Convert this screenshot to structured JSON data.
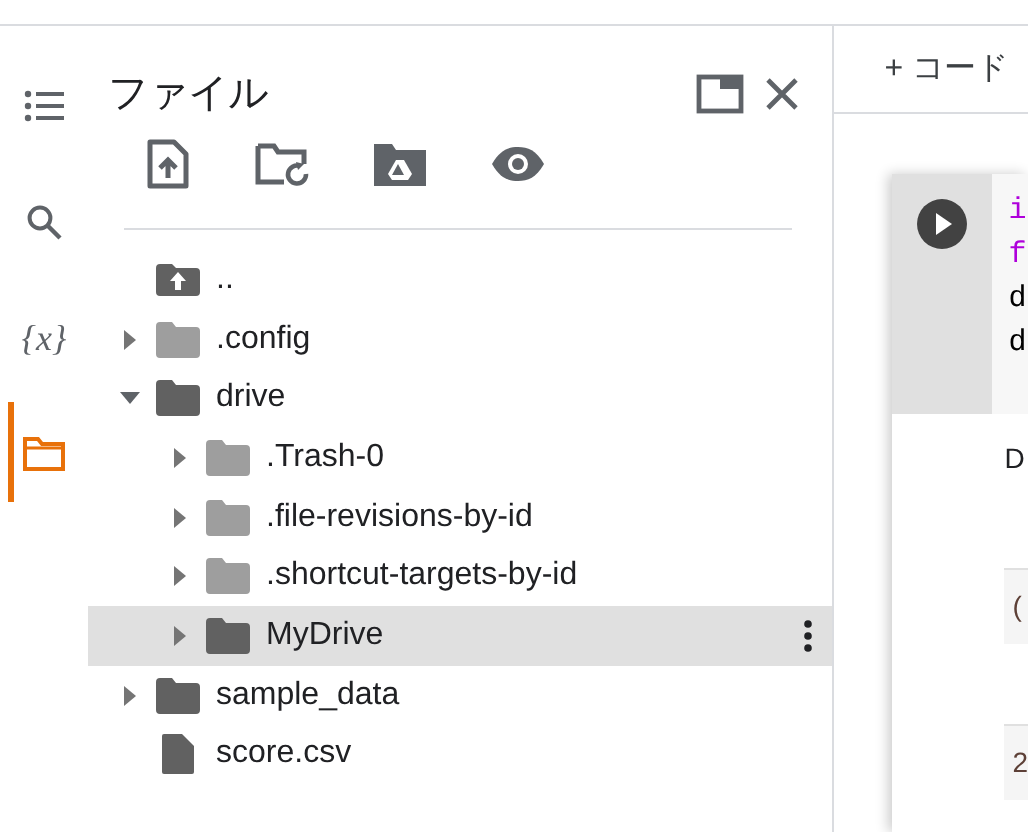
{
  "rail": [
    {
      "kind": "toc",
      "selected": false
    },
    {
      "kind": "search",
      "selected": false
    },
    {
      "kind": "variables",
      "label": "{x}",
      "selected": false
    },
    {
      "kind": "folder",
      "selected": true
    }
  ],
  "panel": {
    "title": "ファイル"
  },
  "tree": [
    {
      "kind": "parent",
      "name": "..",
      "selected": false
    },
    {
      "kind": "folder",
      "name": ".config",
      "dimmed": true,
      "expanded": false,
      "selected": false
    },
    {
      "kind": "folder",
      "name": "drive",
      "dimmed": false,
      "expanded": true,
      "selected": false,
      "children": [
        {
          "kind": "folder",
          "name": ".Trash-0",
          "dimmed": true,
          "expanded": false,
          "selected": false
        },
        {
          "kind": "folder",
          "name": ".file-revisions-by-id",
          "dimmed": true,
          "expanded": false,
          "selected": false
        },
        {
          "kind": "folder",
          "name": ".shortcut-targets-by-id",
          "dimmed": true,
          "expanded": false,
          "selected": false
        },
        {
          "kind": "folder",
          "name": "MyDrive",
          "dimmed": false,
          "expanded": false,
          "selected": true
        }
      ]
    },
    {
      "kind": "folder",
      "name": "sample_data",
      "dimmed": false,
      "expanded": false,
      "selected": false
    },
    {
      "kind": "file",
      "name": "score.csv",
      "selected": false
    }
  ],
  "toolbar": {
    "add_code": "+ コード"
  },
  "cell": {
    "code_lines": [
      {
        "text": "i",
        "kind": "keyword"
      },
      {
        "text": "f",
        "kind": "keyword"
      },
      {
        "text": "d",
        "kind": "plain"
      },
      {
        "text": "d",
        "kind": "plain"
      }
    ],
    "output": "D",
    "output_rows": [
      "(",
      "2"
    ]
  }
}
